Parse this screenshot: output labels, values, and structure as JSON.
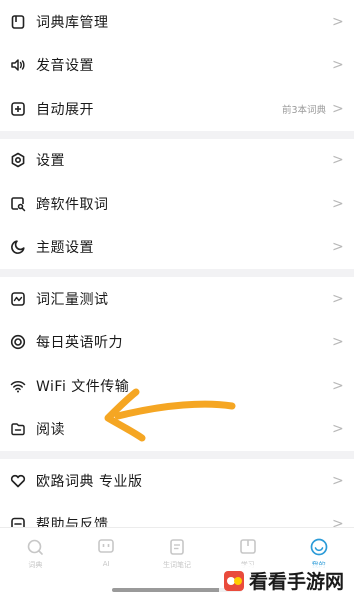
{
  "groups": [
    {
      "items": [
        {
          "icon": "dictionary-library-icon",
          "label": "词典库管理",
          "extra": ""
        },
        {
          "icon": "speaker-icon",
          "label": "发音设置",
          "extra": ""
        },
        {
          "icon": "plus-square-icon",
          "label": "自动展开",
          "extra": "前3本词典"
        }
      ]
    },
    {
      "items": [
        {
          "icon": "gear-hex-icon",
          "label": "设置",
          "extra": ""
        },
        {
          "icon": "search-square-icon",
          "label": "跨软件取词",
          "extra": ""
        },
        {
          "icon": "moon-icon",
          "label": "主题设置",
          "extra": ""
        }
      ]
    },
    {
      "items": [
        {
          "icon": "vocabulary-test-icon",
          "label": "词汇量测试",
          "extra": ""
        },
        {
          "icon": "headphones-icon",
          "label": "每日英语听力",
          "extra": ""
        },
        {
          "icon": "wifi-icon",
          "label": "WiFi 文件传输",
          "extra": ""
        },
        {
          "icon": "folder-icon",
          "label": "阅读",
          "extra": ""
        }
      ]
    },
    {
      "items": [
        {
          "icon": "heart-icon",
          "label": "欧路词典 专业版",
          "extra": ""
        },
        {
          "icon": "feedback-icon",
          "label": "帮助与反馈",
          "extra": ""
        }
      ]
    }
  ],
  "chevron": ">",
  "tabs": [
    {
      "icon": "search-icon",
      "label": "词典",
      "active": false
    },
    {
      "icon": "ai-icon",
      "label": "AI",
      "active": false
    },
    {
      "icon": "notes-icon",
      "label": "生词笔记",
      "active": false
    },
    {
      "icon": "study-icon",
      "label": "学习",
      "active": false
    },
    {
      "icon": "smiley-icon",
      "label": "我的",
      "active": true
    }
  ],
  "watermark": {
    "text": "看看手游网"
  },
  "colors": {
    "accent": "#2b9bd8",
    "arrow": "#f5a623",
    "text": "#1a1a1a"
  }
}
